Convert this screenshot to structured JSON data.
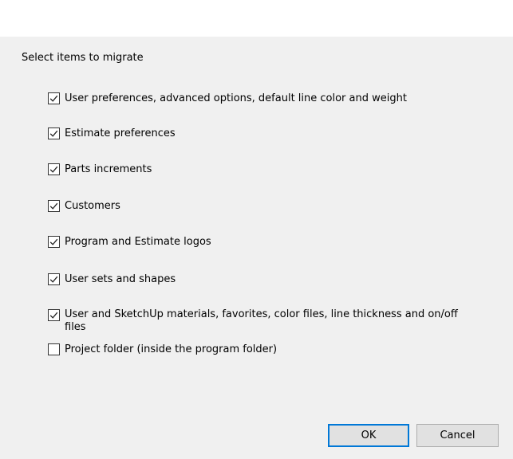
{
  "dialog": {
    "heading": "Select items to migrate",
    "options": [
      {
        "label": "User preferences, advanced options, default line color and weight",
        "checked": true
      },
      {
        "label": "Estimate preferences",
        "checked": true
      },
      {
        "label": "Parts increments",
        "checked": true
      },
      {
        "label": "Customers",
        "checked": true
      },
      {
        "label": "Program and Estimate logos",
        "checked": true
      },
      {
        "label": "User sets and shapes",
        "checked": true
      },
      {
        "label": "User and SketchUp materials, favorites, color files, line thickness and on/off files",
        "checked": true
      },
      {
        "label": "Project folder (inside the program folder)",
        "checked": false
      }
    ],
    "buttons": {
      "ok": "OK",
      "cancel": "Cancel"
    }
  },
  "icons": {
    "checked": "check-mark-icon"
  }
}
